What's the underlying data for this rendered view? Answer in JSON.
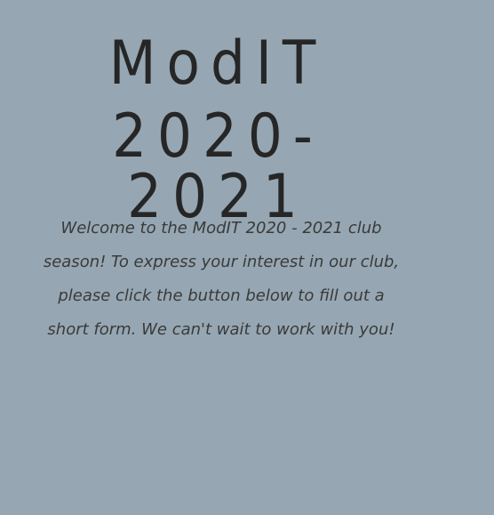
{
  "hero": {
    "title_line1": "ModIT",
    "title_line2": "2020-2021"
  },
  "intro": {
    "paragraph": "Welcome to the ModIT 2020 - 2021 club season! To express your interest in our club, please click the button below to fill out a short form. We can't wait to work with you!"
  },
  "colors": {
    "background": "#96a7b3",
    "title_text": "#262626",
    "body_text": "#3a3a3a"
  }
}
